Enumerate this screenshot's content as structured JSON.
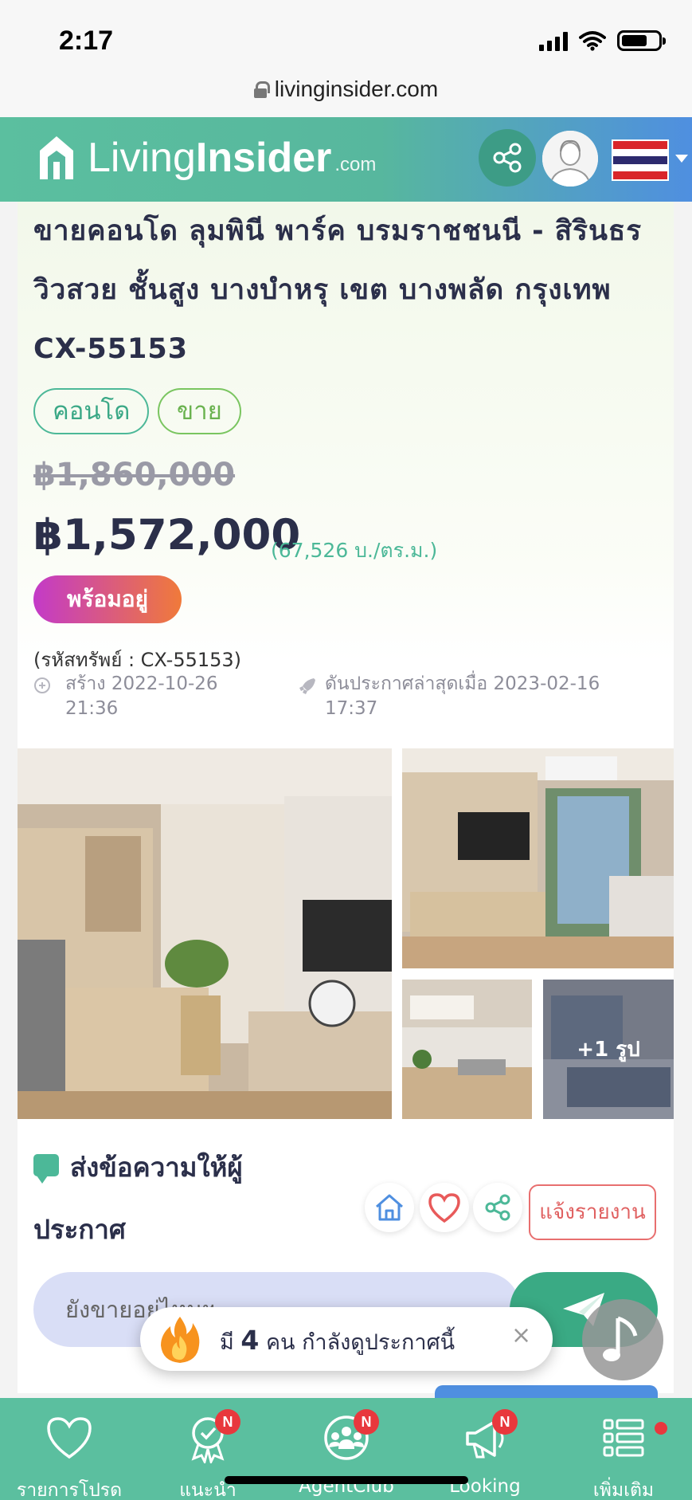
{
  "status_bar": {
    "time": "2:17"
  },
  "browser": {
    "url": "livinginsider.com"
  },
  "header": {
    "logo_living": "Living",
    "logo_insider": "Insider",
    "logo_domain": ".com"
  },
  "listing": {
    "title": "ขายคอนโด ลุมพินี พาร์ค บรมราชชนนี - สิรินธร วิวสวย ชั้นสูง บางบำหรุ เขต บางพลัด กรุงเทพ CX-55153",
    "tags": [
      "คอนโด",
      "ขาย"
    ],
    "old_price": "฿1,860,000",
    "price": "฿1,572,000",
    "price_per_sqm": "(67,526 บ./ตร.ม.)",
    "status_badge": "พร้อมอยู่",
    "code": "(รหัสทรัพย์ : CX-55153)",
    "created": "สร้าง 2022-10-26 21:36",
    "bumped": "ดันประกาศล่าสุดเมื่อ 2023-02-16 17:37",
    "more_photos": "+1 รูป"
  },
  "contact": {
    "title": "ส่งข้อความให้ผู้ประกาศ",
    "report_label": "แจ้งรายงาน",
    "message_value": "ยังขายอยู่ไหมฯ"
  },
  "toast": {
    "prefix": "มี",
    "count": "4",
    "suffix": "คน กำลังดูประกาศนี้",
    "close": "×"
  },
  "bottom_nav": {
    "items": [
      {
        "label": "รายการโปรด",
        "icon": "heart-icon",
        "badge": ""
      },
      {
        "label": "แนะนำ",
        "icon": "award-icon",
        "badge": "N"
      },
      {
        "label": "AgentClub",
        "icon": "agent-group-icon",
        "badge": "N"
      },
      {
        "label": "Looking",
        "icon": "megaphone-icon",
        "badge": "N"
      },
      {
        "label": "เพิ่มเติม",
        "icon": "menu-list-icon",
        "badge": ""
      }
    ]
  },
  "colors": {
    "brand_green": "#5bbf9f",
    "brand_blue": "#4f8fe0",
    "title_navy": "#2b2f4a",
    "report_red": "#e86f6f"
  }
}
